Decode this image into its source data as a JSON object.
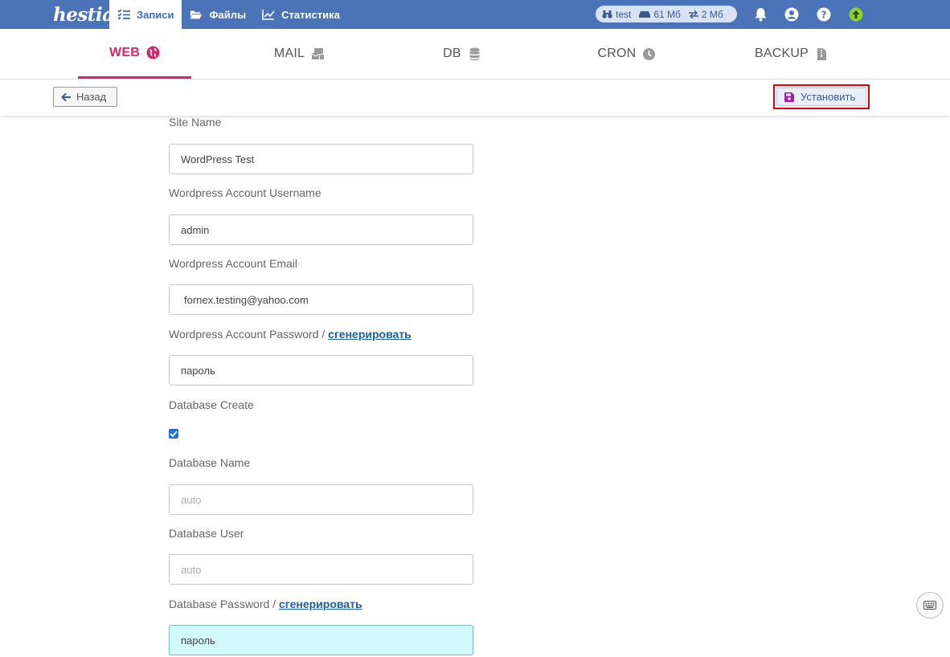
{
  "topbar": {
    "logo": "hestia",
    "nav": [
      {
        "label": "Записи",
        "active": true
      },
      {
        "label": "Файлы",
        "active": false
      },
      {
        "label": "Статистика",
        "active": false
      }
    ],
    "stats": {
      "user": "test",
      "disk": "61 Мб",
      "bandwidth": "2 Мб"
    }
  },
  "tabs": [
    {
      "label": "WEB",
      "active": true
    },
    {
      "label": "MAIL",
      "active": false
    },
    {
      "label": "DB",
      "active": false
    },
    {
      "label": "CRON",
      "active": false
    },
    {
      "label": "BACKUP",
      "active": false
    }
  ],
  "toolbar": {
    "back_label": "Назад",
    "install_label": "Установить"
  },
  "form": {
    "site_name": {
      "label": "Site Name",
      "value": "WordPress Test"
    },
    "username": {
      "label": "Wordpress Account Username",
      "value": "admin"
    },
    "email": {
      "label": "Wordpress Account Email",
      "value": "fornex.testing@yahoo.com"
    },
    "password": {
      "label": "Wordpress Account Password / ",
      "link": "сгенерировать",
      "value": "пароль"
    },
    "db_create": {
      "label": "Database Create",
      "checked": true
    },
    "db_name": {
      "label": "Database Name",
      "placeholder": "auto"
    },
    "db_user": {
      "label": "Database User",
      "placeholder": "auto"
    },
    "db_password": {
      "label": "Database Password / ",
      "link": "сгенерировать",
      "value": "пароль"
    }
  },
  "colors": {
    "topbar": "#4b73b8",
    "accent": "#d6266a",
    "highlight": "#e00012",
    "active_field": "#d2fafd"
  }
}
